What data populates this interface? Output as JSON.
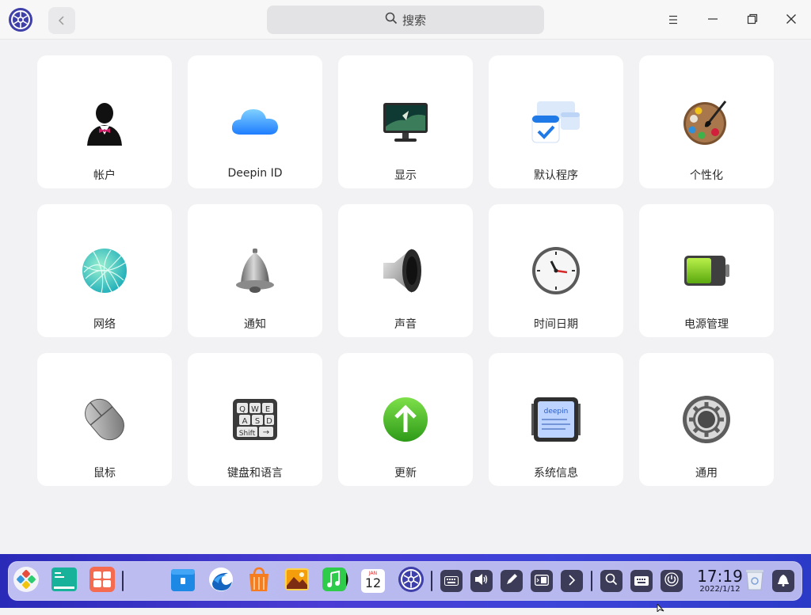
{
  "titlebar": {
    "search_placeholder": "搜索",
    "icons": [
      "control-center-logo-icon",
      "back-arrow-icon",
      "search-icon",
      "menu-icon",
      "minimize-icon",
      "maximize-icon",
      "close-icon"
    ]
  },
  "modules": [
    {
      "label": "帐户",
      "icon": "accounts-icon"
    },
    {
      "label": "Deepin ID",
      "icon": "cloud-icon"
    },
    {
      "label": "显示",
      "icon": "display-monitor-icon"
    },
    {
      "label": "默认程序",
      "icon": "default-apps-icon"
    },
    {
      "label": "个性化",
      "icon": "palette-icon"
    },
    {
      "label": "网络",
      "icon": "network-globe-icon"
    },
    {
      "label": "通知",
      "icon": "bell-icon"
    },
    {
      "label": "声音",
      "icon": "speaker-icon"
    },
    {
      "label": "时间日期",
      "icon": "clock-icon"
    },
    {
      "label": "电源管理",
      "icon": "battery-icon"
    },
    {
      "label": "鼠标",
      "icon": "mouse-icon"
    },
    {
      "label": "键盘和语言",
      "icon": "keyboard-icon"
    },
    {
      "label": "更新",
      "icon": "update-arrow-icon"
    },
    {
      "label": "系统信息",
      "icon": "system-info-icon"
    },
    {
      "label": "通用",
      "icon": "gear-icon"
    }
  ],
  "dock": {
    "apps": [
      "launcher-icon",
      "terminal-icon",
      "multitask-view-icon",
      "file-manager-icon",
      "browser-icon",
      "app-store-icon",
      "image-viewer-icon",
      "music-icon",
      "calendar-icon",
      "control-center-icon"
    ],
    "calendar_month": "JAN",
    "calendar_day": "12",
    "tray": [
      "onscreen-keyboard-icon",
      "volume-icon",
      "pen-icon",
      "display-mode-icon",
      "expand-tray-icon",
      "search-icon",
      "keyboard-layout-icon",
      "power-icon",
      "trash-icon",
      "notification-icon"
    ],
    "time": "17:19",
    "date": "2022/1/12"
  },
  "colors": {
    "background": "#f2f2f4",
    "tile": "#ffffff",
    "dock_gradient_start": "#2a2ab8",
    "dock_panel": "#bfbef2"
  }
}
